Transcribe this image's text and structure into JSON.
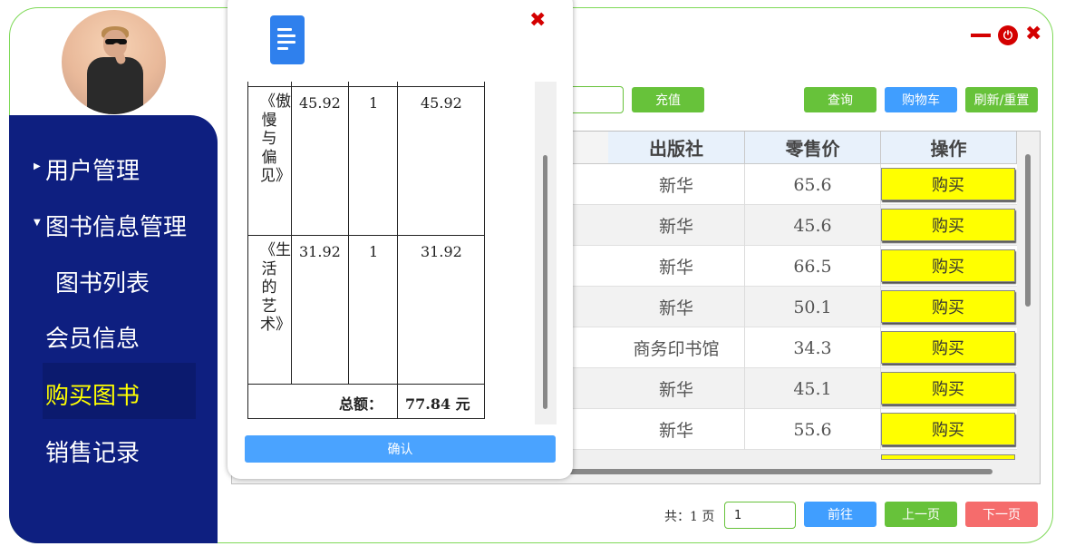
{
  "sidebar": {
    "items": [
      {
        "label": "用户管理"
      },
      {
        "label": "图书信息管理"
      },
      {
        "label": "图书列表"
      },
      {
        "label": "会员信息"
      },
      {
        "label": "购买图书"
      },
      {
        "label": "销售记录"
      }
    ]
  },
  "toolbar": {
    "recharge_label": "充值",
    "query_label": "查询",
    "cart_label": "购物车",
    "refresh_label": "刷新/重置"
  },
  "table": {
    "headers": [
      "出版社",
      "零售价",
      "操作"
    ],
    "rows": [
      {
        "publisher": "新华",
        "price": "65.6",
        "action": "购买"
      },
      {
        "publisher": "新华",
        "price": "45.6",
        "action": "购买"
      },
      {
        "publisher": "新华",
        "price": "66.5",
        "action": "购买"
      },
      {
        "publisher": "新华",
        "price": "50.1",
        "action": "购买"
      },
      {
        "publisher": "商务印书馆",
        "price": "34.3",
        "action": "购买"
      },
      {
        "publisher": "新华",
        "price": "45.1",
        "action": "购买"
      },
      {
        "publisher": "新华",
        "price": "55.6",
        "action": "购买"
      }
    ]
  },
  "pager": {
    "total_text": "共：1 页",
    "page_value": "1",
    "goto_label": "前往",
    "prev_label": "上一页",
    "next_label": "下一页"
  },
  "dialog": {
    "items": [
      {
        "title": "《傲慢与偏见》",
        "unit_price": "45.92",
        "qty": "1",
        "subtotal": "45.92"
      },
      {
        "title": "《生活的艺术》",
        "unit_price": "31.92",
        "qty": "1",
        "subtotal": "31.92"
      }
    ],
    "total_label": "总额：",
    "total_value": "77.84 元",
    "confirm_label": "确认"
  },
  "colors": {
    "sidebar": "#0e1f80",
    "active_nav": "#ffff00",
    "green": "#67c23a",
    "blue": "#409eff",
    "red": "#f56c6c",
    "buy_button": "#ffff00"
  }
}
